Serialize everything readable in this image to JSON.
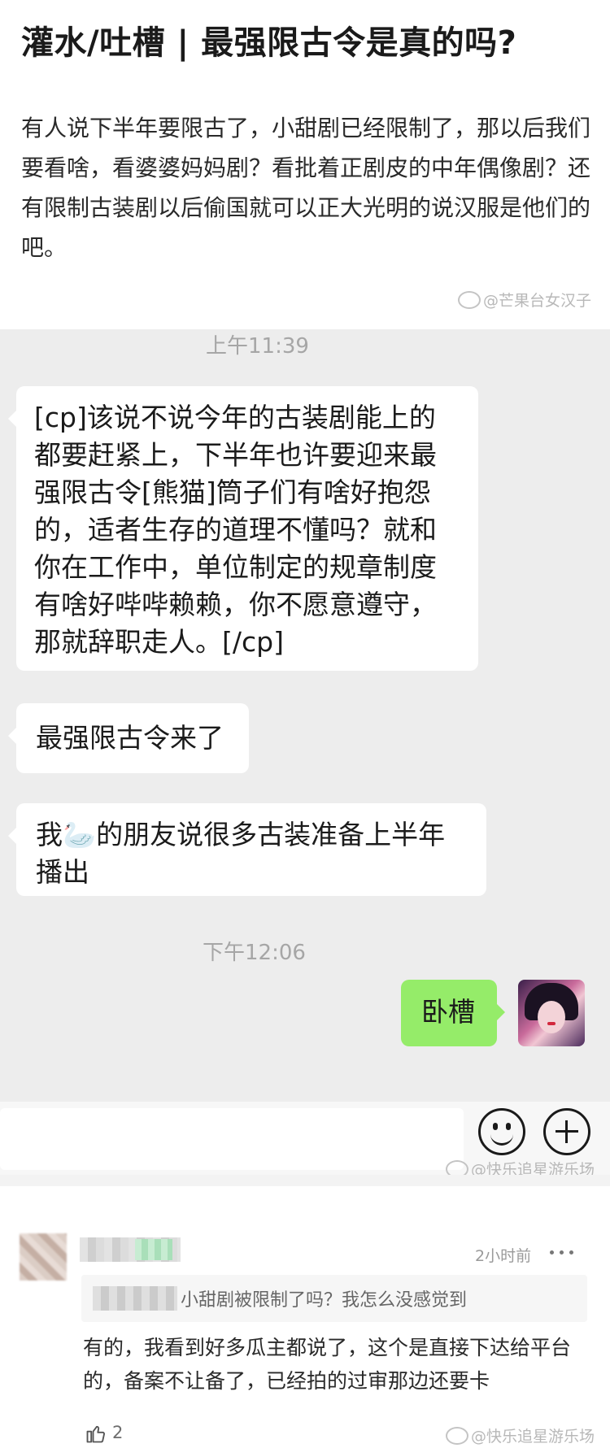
{
  "post": {
    "title": "灌水/吐槽 | 最强限古令是真的吗?",
    "body": "有人说下半年要限古了，小甜剧已经限制了，那以后我们要看啥，看婆婆妈妈剧？看批着正剧皮的中年偶像剧？还有限制古装剧以后偷国就可以正大光明的说汉服是他们的吧。",
    "watermark": "@芒果台女汉子"
  },
  "chat": {
    "timestamp_1": "上午11:39",
    "messages": [
      {
        "text": "[cp]该说不说今年的古装剧能上的都要赶紧上，下半年也许要迎来最强限古令[熊猫]筒子们有啥好抱怨的，适者生存的道理不懂吗？就和你在工作中，单位制定的规章制度有啥好哔哔赖赖，你不愿意遵守，那就辞职走人。[/cp]"
      },
      {
        "text": "最强限古令来了"
      },
      {
        "text_a": "我",
        "emoji": "🦢",
        "text_b": "的朋友说很多古装准备上半年播出"
      }
    ],
    "timestamp_2": "下午12:06",
    "my_message": "卧槽",
    "watermark": "@快乐追星游乐场"
  },
  "input_bar": {
    "emoji_icon": "smiley-face-icon",
    "plus_icon": "plus-circle-icon"
  },
  "comment": {
    "time": "2小时前",
    "quote": "小甜剧被限制了吗？我怎么没感觉到",
    "text": "有的，我看到好多瓜主都说了，这个是直接下达给平台的，备案不让备了，已经拍的过审那边还要卡",
    "likes": "2",
    "watermark": "@快乐追星游乐场"
  },
  "colors": {
    "chat_bg": "#ededed",
    "my_bubble": "#95ec69",
    "other_bubble": "#ffffff"
  }
}
